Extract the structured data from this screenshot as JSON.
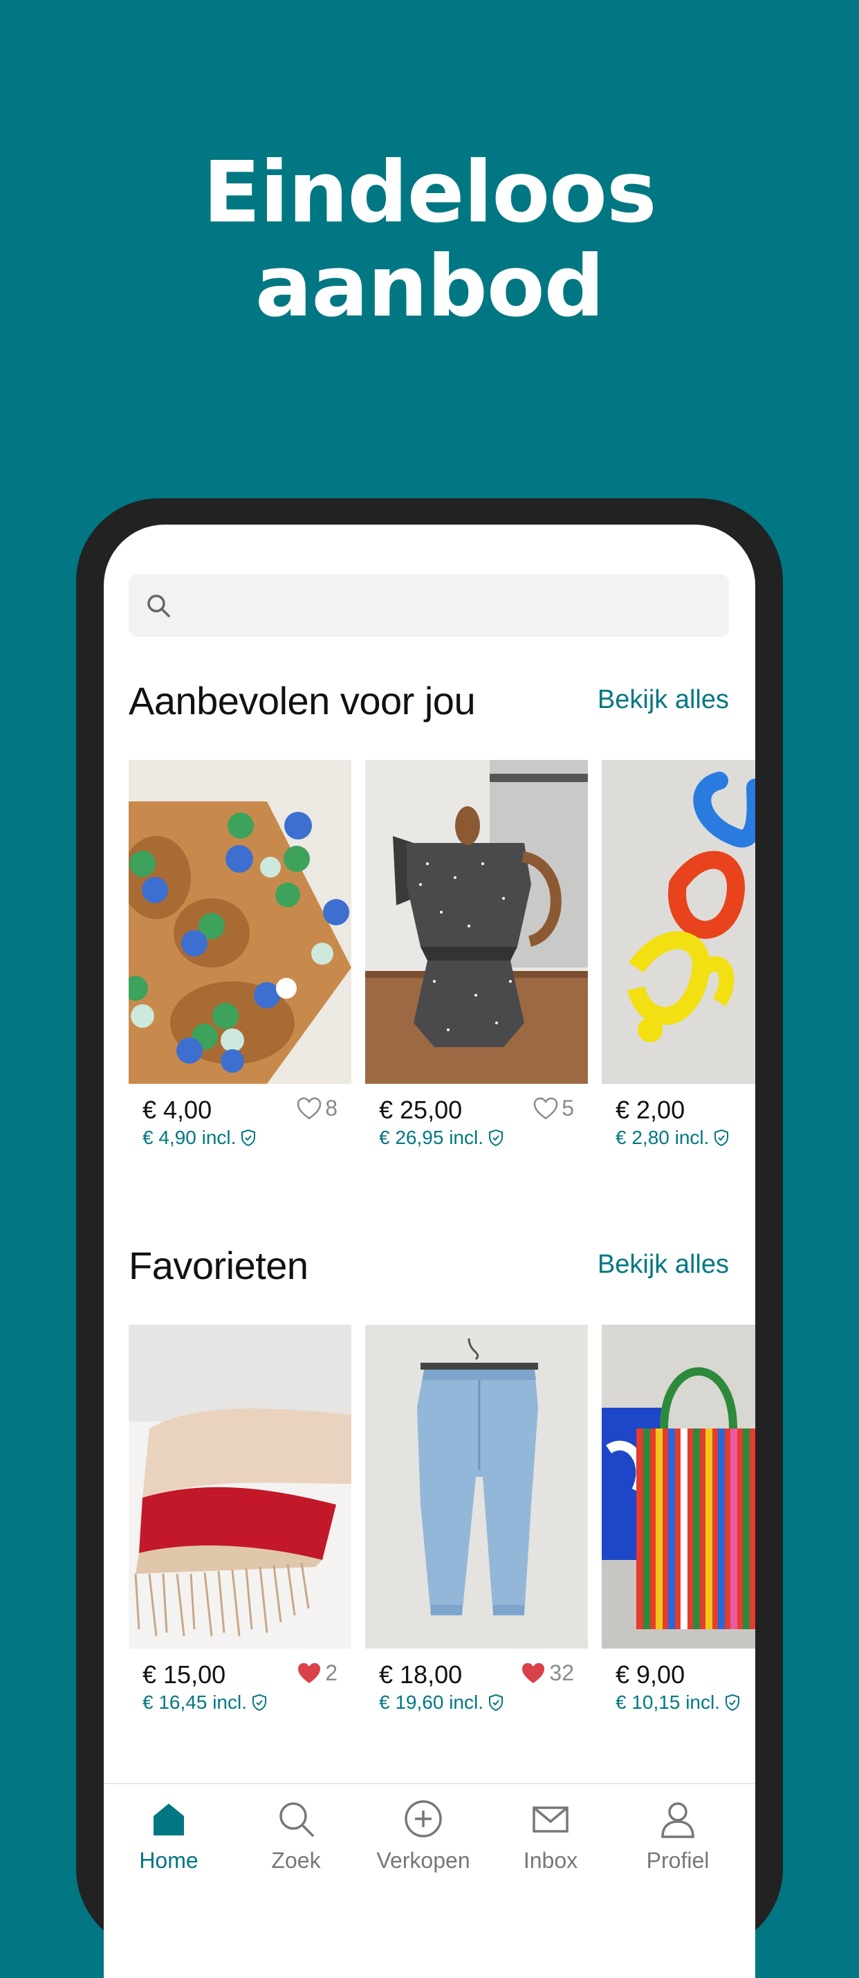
{
  "headline": {
    "line1": "Eindeloos",
    "line2": "aanbod"
  },
  "search": {
    "placeholder": ""
  },
  "sections": [
    {
      "title": "Aanbevolen voor jou",
      "see_all": "Bekijk alles",
      "items": [
        {
          "price": "€ 4,00",
          "incl": "€ 4,90 incl.",
          "likes": "8",
          "liked": false,
          "image": "glass-marbles-on-wooden-board"
        },
        {
          "price": "€ 25,00",
          "incl": "€ 26,95 incl.",
          "likes": "5",
          "liked": false,
          "image": "speckled-moka-pot"
        },
        {
          "price": "€ 2,00",
          "incl": "€ 2,80 incl.",
          "likes": "",
          "liked": false,
          "image": "rubber-dog-toy-chain"
        }
      ]
    },
    {
      "title": "Favorieten",
      "see_all": "Bekijk alles",
      "items": [
        {
          "price": "€ 15,00",
          "incl": "€ 16,45 incl.",
          "likes": "2",
          "liked": true,
          "image": "folded-scarves"
        },
        {
          "price": "€ 18,00",
          "incl": "€ 19,60 incl.",
          "likes": "32",
          "liked": true,
          "image": "blue-jeans-on-hanger"
        },
        {
          "price": "€ 9,00",
          "incl": "€ 10,15 incl.",
          "likes": "",
          "liked": false,
          "image": "striped-tote-bag"
        }
      ]
    }
  ],
  "tabs": [
    {
      "label": "Home",
      "icon": "home-icon",
      "active": true
    },
    {
      "label": "Zoek",
      "icon": "search-icon",
      "active": false
    },
    {
      "label": "Verkopen",
      "icon": "plus-circle-icon",
      "active": false
    },
    {
      "label": "Inbox",
      "icon": "mail-icon",
      "active": false
    },
    {
      "label": "Profiel",
      "icon": "user-icon",
      "active": false
    }
  ],
  "colors": {
    "brand": "#007782",
    "liked_heart": "#d9414b"
  }
}
